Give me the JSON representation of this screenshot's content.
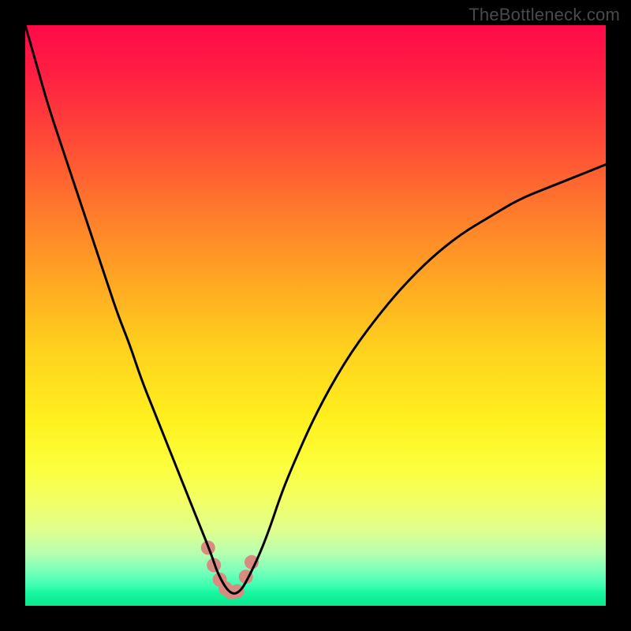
{
  "watermark": {
    "text": "TheBottleneck.com"
  },
  "colors": {
    "frame_bg": "#000000",
    "curve_stroke": "#000000",
    "dot_fill": "#d88b80",
    "gradient_stops": [
      "#ff0a48",
      "#ff4a37",
      "#ffa723",
      "#fff01e",
      "#b6ffb0",
      "#0ce98e"
    ]
  },
  "chart_data": {
    "type": "line",
    "title": "",
    "xlabel": "",
    "ylabel": "",
    "xlim": [
      0,
      100
    ],
    "ylim": [
      0,
      100
    ],
    "grid": false,
    "legend": false,
    "series": [
      {
        "name": "bottleneck-curve",
        "x": [
          0,
          2,
          4,
          6,
          8,
          10,
          12,
          14,
          16,
          18,
          20,
          22,
          24,
          26,
          28,
          30,
          32,
          33,
          34,
          35,
          36,
          37,
          38,
          40,
          42,
          44,
          46,
          50,
          55,
          60,
          65,
          70,
          75,
          80,
          85,
          90,
          95,
          100
        ],
        "y": [
          100,
          93,
          86,
          80,
          74,
          68,
          62,
          56,
          50,
          45,
          39,
          34,
          29,
          24,
          19,
          14,
          9,
          6,
          4,
          2.5,
          2,
          2.5,
          4,
          8,
          13,
          19,
          24,
          33,
          42,
          49,
          55,
          60,
          64,
          67,
          70,
          72,
          74,
          76
        ]
      }
    ],
    "annotations": [
      {
        "name": "min-region-dot",
        "x": 31.5,
        "y": 10
      },
      {
        "name": "min-region-dot",
        "x": 32.5,
        "y": 7
      },
      {
        "name": "min-region-dot",
        "x": 33.5,
        "y": 4.5
      },
      {
        "name": "min-region-dot",
        "x": 34.5,
        "y": 3
      },
      {
        "name": "min-region-dot",
        "x": 35.5,
        "y": 2.3
      },
      {
        "name": "min-region-dot",
        "x": 36.5,
        "y": 2.5
      },
      {
        "name": "min-region-dot",
        "x": 38.0,
        "y": 5
      },
      {
        "name": "min-region-dot",
        "x": 39.0,
        "y": 7.5
      }
    ]
  }
}
